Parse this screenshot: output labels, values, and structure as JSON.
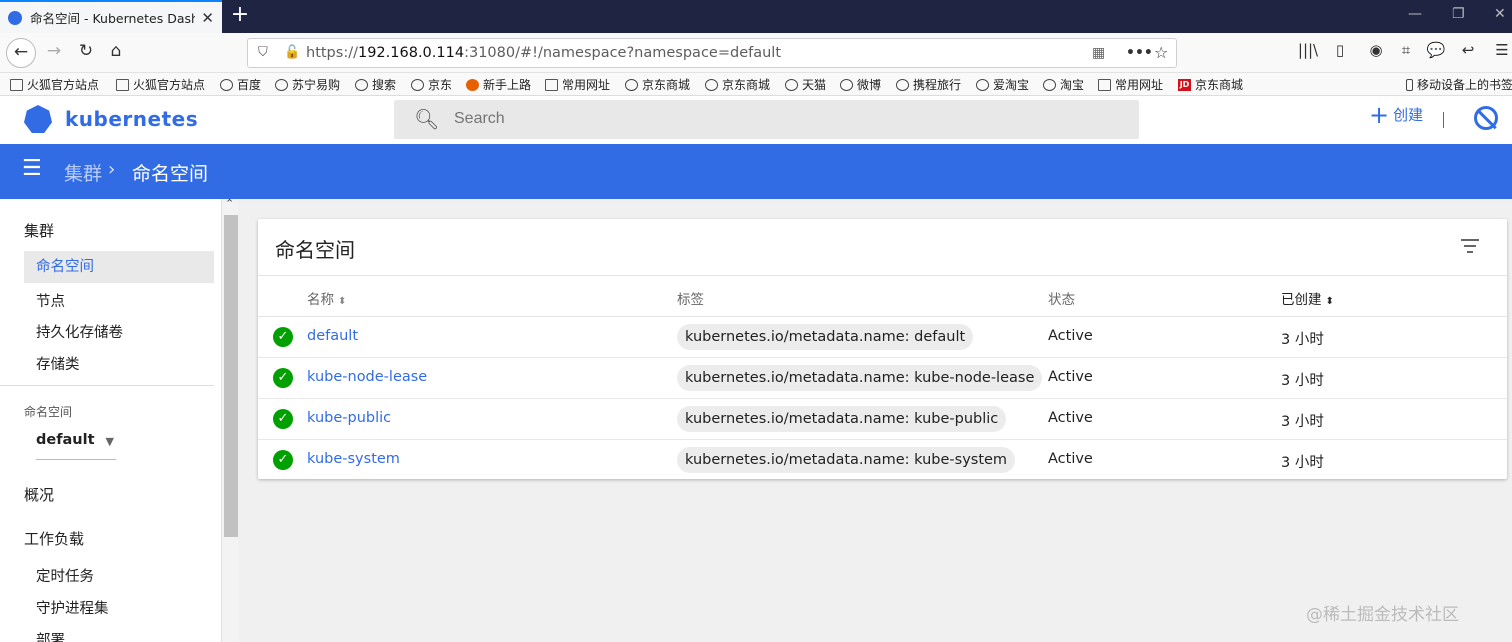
{
  "browser": {
    "tab_title": "命名空间 - Kubernetes Dashb",
    "url_scheme": "https://",
    "url_host": "192.168.0.114",
    "url_rest": ":31080/#!/namespace?namespace=default",
    "bookmarks": [
      {
        "label": "火狐官方站点",
        "icon": "folder-icon"
      },
      {
        "label": "火狐官方站点",
        "icon": "folder-icon"
      },
      {
        "label": "百度",
        "icon": "globe-icon"
      },
      {
        "label": "苏宁易购",
        "icon": "globe-icon"
      },
      {
        "label": "搜索",
        "icon": "globe-icon"
      },
      {
        "label": "京东",
        "icon": "globe-icon"
      },
      {
        "label": "新手上路",
        "icon": "firefox-icon"
      },
      {
        "label": "常用网址",
        "icon": "folder-icon"
      },
      {
        "label": "京东商城",
        "icon": "globe-icon"
      },
      {
        "label": "京东商城",
        "icon": "globe-icon"
      },
      {
        "label": "天猫",
        "icon": "globe-icon"
      },
      {
        "label": "微博",
        "icon": "globe-icon"
      },
      {
        "label": "携程旅行",
        "icon": "globe-icon"
      },
      {
        "label": "爱淘宝",
        "icon": "globe-icon"
      },
      {
        "label": "淘宝",
        "icon": "globe-icon"
      },
      {
        "label": "常用网址",
        "icon": "folder-icon"
      },
      {
        "label": "京东商城",
        "icon": "jd-icon"
      }
    ],
    "mobile_bookmarks": "移动设备上的书签"
  },
  "app": {
    "logo_text": "kubernetes",
    "search_placeholder": "Search",
    "create_label": "创建",
    "brand_color": "#326ce5"
  },
  "breadcrumb": {
    "parent": "集群",
    "current": "命名空间"
  },
  "sidebar": {
    "cluster_heading": "集群",
    "cluster_items": [
      "命名空间",
      "节点",
      "持久化存储卷",
      "存储类"
    ],
    "namespace_label": "命名空间",
    "namespace_value": "default",
    "overview": "概况",
    "workloads_heading": "工作负载",
    "workload_items": [
      "定时任务",
      "守护进程集",
      "部署"
    ]
  },
  "card": {
    "title": "命名空间",
    "columns": [
      "名称",
      "标签",
      "状态",
      "已创建"
    ],
    "rows": [
      {
        "name": "default",
        "label": "kubernetes.io/metadata.name: default",
        "status": "Active",
        "created": "3 小时"
      },
      {
        "name": "kube-node-lease",
        "label": "kubernetes.io/metadata.name: kube-node-lease",
        "status": "Active",
        "created": "3 小时"
      },
      {
        "name": "kube-public",
        "label": "kubernetes.io/metadata.name: kube-public",
        "status": "Active",
        "created": "3 小时"
      },
      {
        "name": "kube-system",
        "label": "kubernetes.io/metadata.name: kube-system",
        "status": "Active",
        "created": "3 小时"
      }
    ]
  },
  "watermark": "@稀土掘金技术社区"
}
